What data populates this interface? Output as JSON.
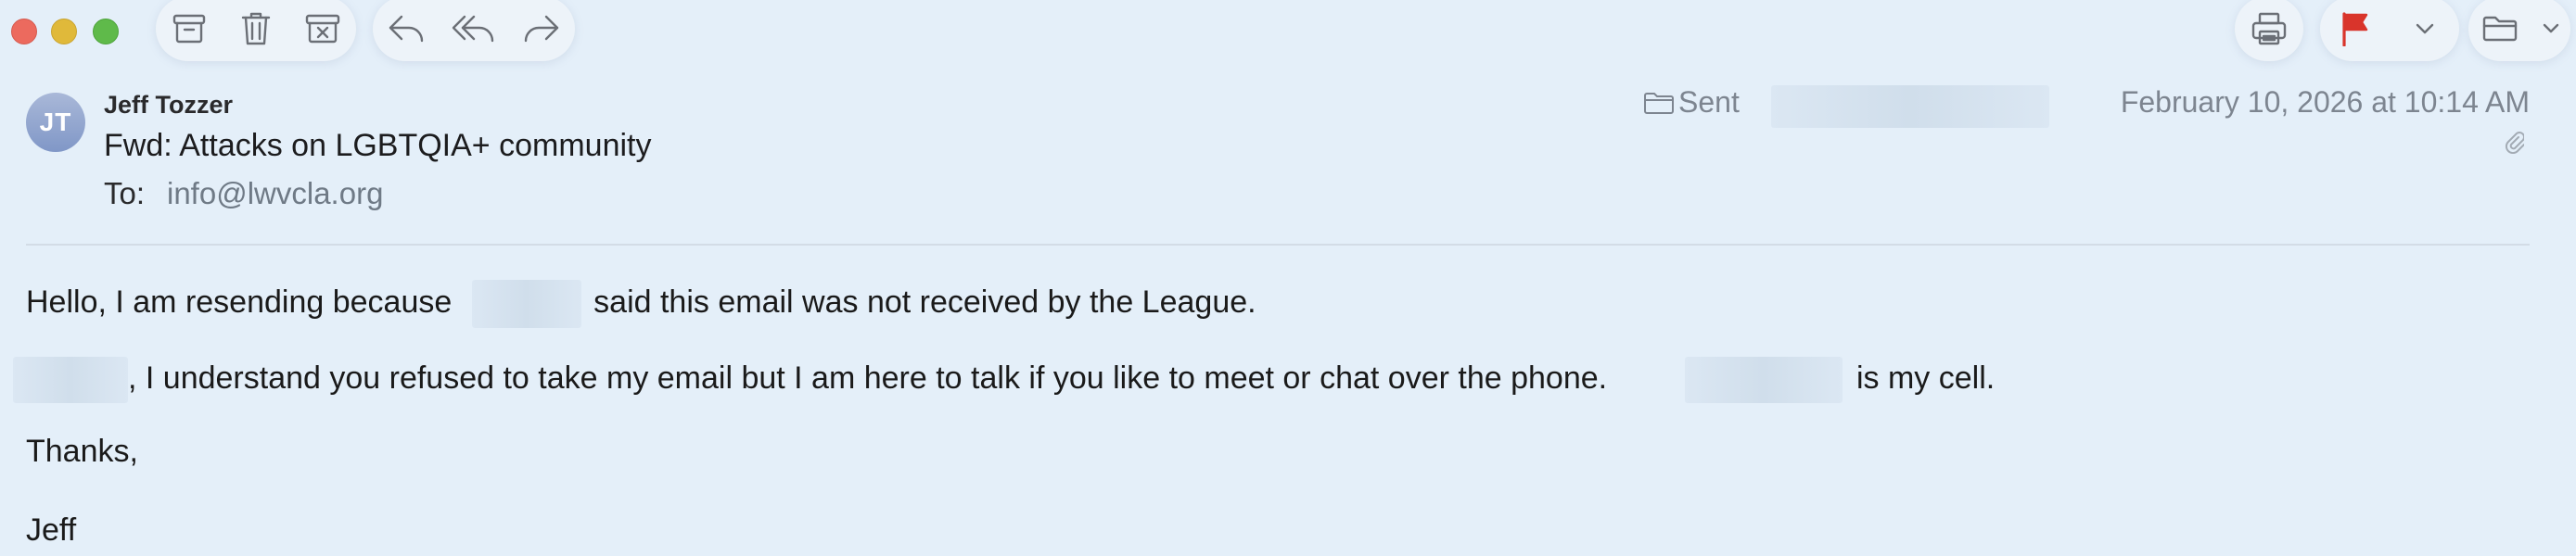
{
  "toolbar": {
    "buttons": [
      {
        "name": "archive-icon"
      },
      {
        "name": "trash-icon"
      },
      {
        "name": "junk-icon"
      },
      {
        "name": "reply-icon"
      },
      {
        "name": "reply-all-icon"
      },
      {
        "name": "forward-icon"
      },
      {
        "name": "print-icon"
      },
      {
        "name": "flag-icon"
      },
      {
        "name": "chevron-down-icon"
      },
      {
        "name": "move-folder-icon"
      }
    ],
    "flag_color": "#d9342b"
  },
  "message": {
    "avatar_initials": "JT",
    "sender": "Jeff Tozzer",
    "subject": "Fwd: Attacks on LGBTQIA+ community",
    "to_label": "To:",
    "to_value": "info@lwvcla.org",
    "mailbox": "Sent",
    "date": "February 10, 2026 at 10:14 AM"
  },
  "body": {
    "line1_a": "Hello, I am resending because",
    "line1_b": "said this email was not received by the League.",
    "line2_a": ", I understand you refused to take my email but I am here to talk if you like to meet or chat over the phone.",
    "line2_b": "is  my cell.",
    "line3": "Thanks,",
    "line4": "Jeff"
  }
}
